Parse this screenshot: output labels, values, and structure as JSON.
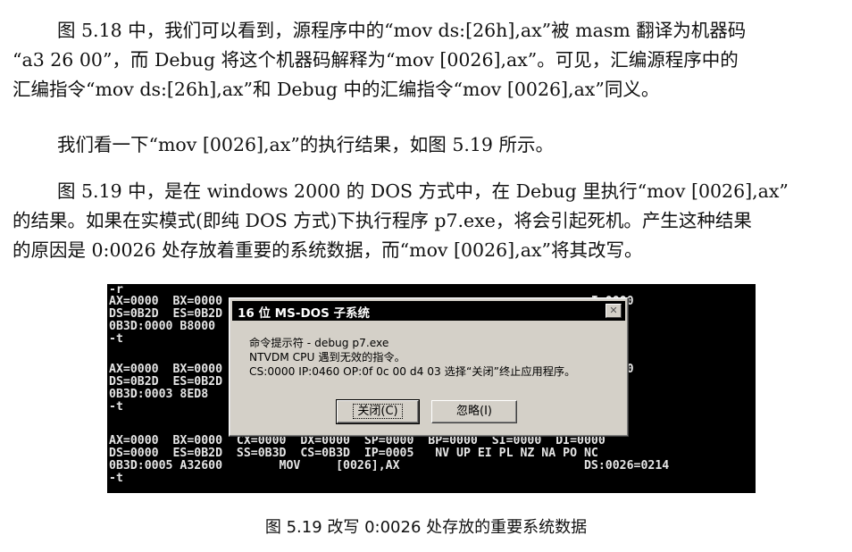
{
  "paragraph1": [
    "图 5.18 中，我们可以看到，源程序中的“mov ds:[26h],ax”被 masm 翻译为机器码",
    "“a3 26 00”，而 Debug 将这个机器码解释为“mov [0026],ax”。可见，汇编源程序中的",
    "汇编指令“mov ds:[26h],ax”和 Debug 中的汇编指令“mov [0026],ax”同义。"
  ],
  "paragraph2": [
    "我们看一下“mov [0026],ax”的执行结果，如图 5.19 所示。"
  ],
  "paragraph3": [
    "图 5.19 中，是在 windows 2000 的 DOS 方式中，在 Debug 里执行“mov [0026],ax”",
    "的结果。如果在实模式(即纯 DOS 方式)下执行程序 p7.exe，将会引起死机。产生这种结果",
    "的原因是 0:0026 处存放着重要的系统数据，而“mov [0026],ax”将其改写。"
  ],
  "terminal": [
    "-r",
    "AX=0000  BX=0000                                                    I=0000",
    "DS=0B2D  ES=0B2D                                                    PO NC",
    "0B3D:0000 B8000",
    "-t",
    "",
    "AX=0000  BX=0000                                                    I=0000",
    "DS=0B2D  ES=0B2D                                                    PO NC",
    "0B3D:0003 8ED8",
    "-t",
    "",
    "AX=0000  BX=0000  CX=0000  DX=0000  SP=0000  BP=0000  SI=0000  DI=0000",
    "DS=0000  ES=0B2D  SS=0B3D  CS=0B3D  IP=0005   NV UP EI PL NZ NA PO NC",
    "0B3D:0005 A32600        MOV     [0026],AX                          DS:0026=0214",
    "-t"
  ],
  "dialog": {
    "title": "16 位 MS-DOS 子系统",
    "close_glyph": "✕",
    "message_line1": "命令提示符 - debug p7.exe",
    "message_line2": "NTVDM CPU 遇到无效的指令。",
    "message_line3": "CS:0000 IP:0460 OP:0f 0c 00 d4 03 选择“关闭”终止应用程序。",
    "close_button": "关闭(C)",
    "ignore_button": "忽略(I)"
  },
  "caption": "图 5.19   改写 0:0026 处存放的重要系统数据"
}
